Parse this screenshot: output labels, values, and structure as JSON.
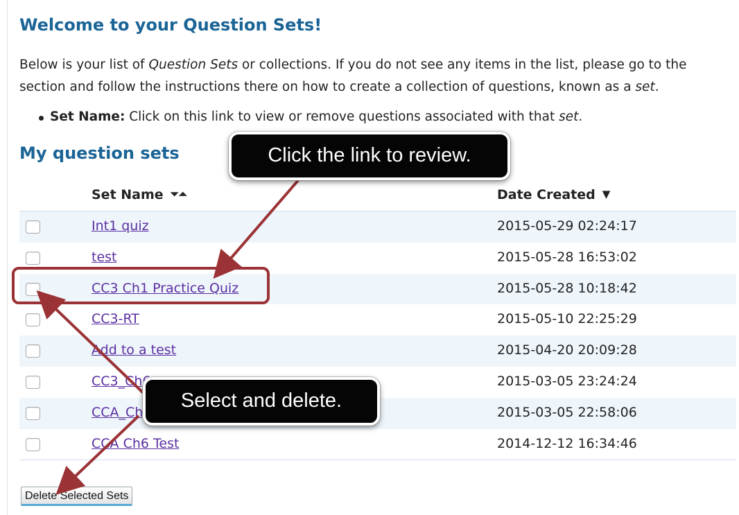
{
  "welcome_title": "Welcome to your Question Sets!",
  "intro": {
    "line1_a": "Below is your list of ",
    "line1_em": "Question Sets",
    "line1_b": " or collections. If you do not see any items in the list, please go to the",
    "line2_a": "section and follow the instructions there on how to create a collection of questions, known as a ",
    "line2_em": "set",
    "line2_b": "."
  },
  "bullet": {
    "label": "Set Name:",
    "text_a": " Click on this link to view or remove questions associated with that ",
    "text_em": "set",
    "text_b": "."
  },
  "section_title": "My question sets",
  "table": {
    "columns": {
      "name": "Set Name",
      "date": "Date Created"
    },
    "rows": [
      {
        "name": "Int1 quiz",
        "date": "2015-05-29 02:24:17"
      },
      {
        "name": "test",
        "date": "2015-05-28 16:53:02"
      },
      {
        "name": "CC3 Ch1 Practice Quiz",
        "date": "2015-05-28 10:18:42"
      },
      {
        "name": "CC3-RT",
        "date": "2015-05-10 22:25:29"
      },
      {
        "name": "Add to a test",
        "date": "2015-04-20 20:09:28"
      },
      {
        "name": "CC3_Ch6",
        "date": "2015-03-05 23:24:24"
      },
      {
        "name": "CCA_Ch6",
        "date": "2015-03-05 22:58:06"
      },
      {
        "name": "CCA Ch6 Test",
        "date": "2014-12-12 16:34:46"
      }
    ]
  },
  "delete_button": "Delete Selected Sets",
  "callouts": {
    "review": "Click the link to review.",
    "select": "Select and delete."
  },
  "colors": {
    "heading": "#1a6496",
    "link": "#5a2fa0",
    "annotation": "#9b3235",
    "row_alt": "#eef5fb"
  },
  "icons": {
    "sort_name": "sort-both-icon",
    "sort_date": "sort-desc-icon"
  }
}
